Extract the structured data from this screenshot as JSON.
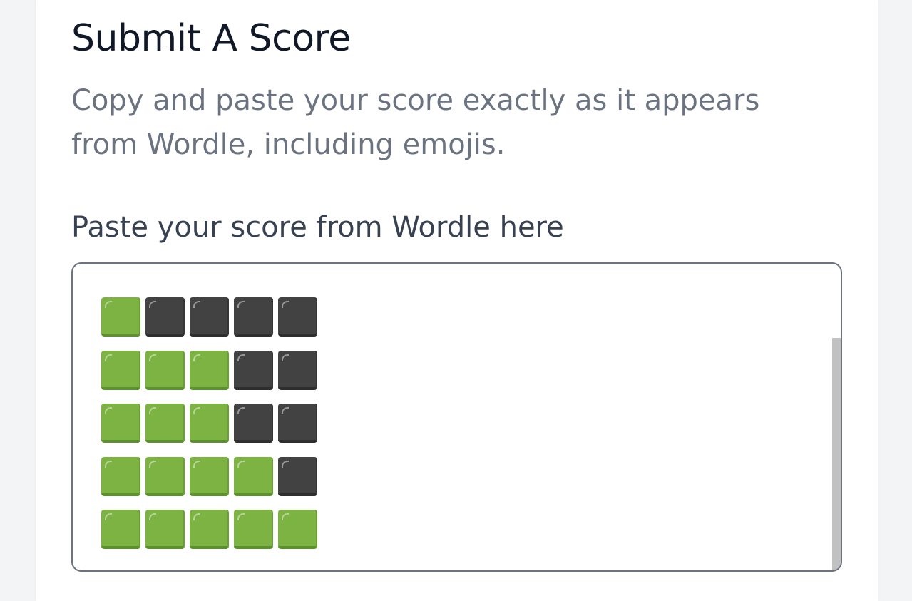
{
  "form": {
    "title": "Submit A Score",
    "subtitle": "Copy and paste your score exactly as it appears from Wordle, including emojis.",
    "field_label": "Paste your score from Wordle here"
  },
  "score_grid": {
    "rows": [
      [
        "green",
        "gray",
        "gray",
        "gray",
        "gray"
      ],
      [
        "green",
        "green",
        "green",
        "gray",
        "gray"
      ],
      [
        "green",
        "green",
        "green",
        "gray",
        "gray"
      ],
      [
        "green",
        "green",
        "green",
        "green",
        "gray"
      ],
      [
        "green",
        "green",
        "green",
        "green",
        "green"
      ]
    ],
    "legend": {
      "green": "green-square-emoji",
      "gray": "black-square-emoji"
    }
  },
  "colors": {
    "green": "#7cb342",
    "gray": "#424242",
    "title": "#111827",
    "subtitle": "#6b7280",
    "label": "#374151",
    "border": "#6b7280"
  }
}
